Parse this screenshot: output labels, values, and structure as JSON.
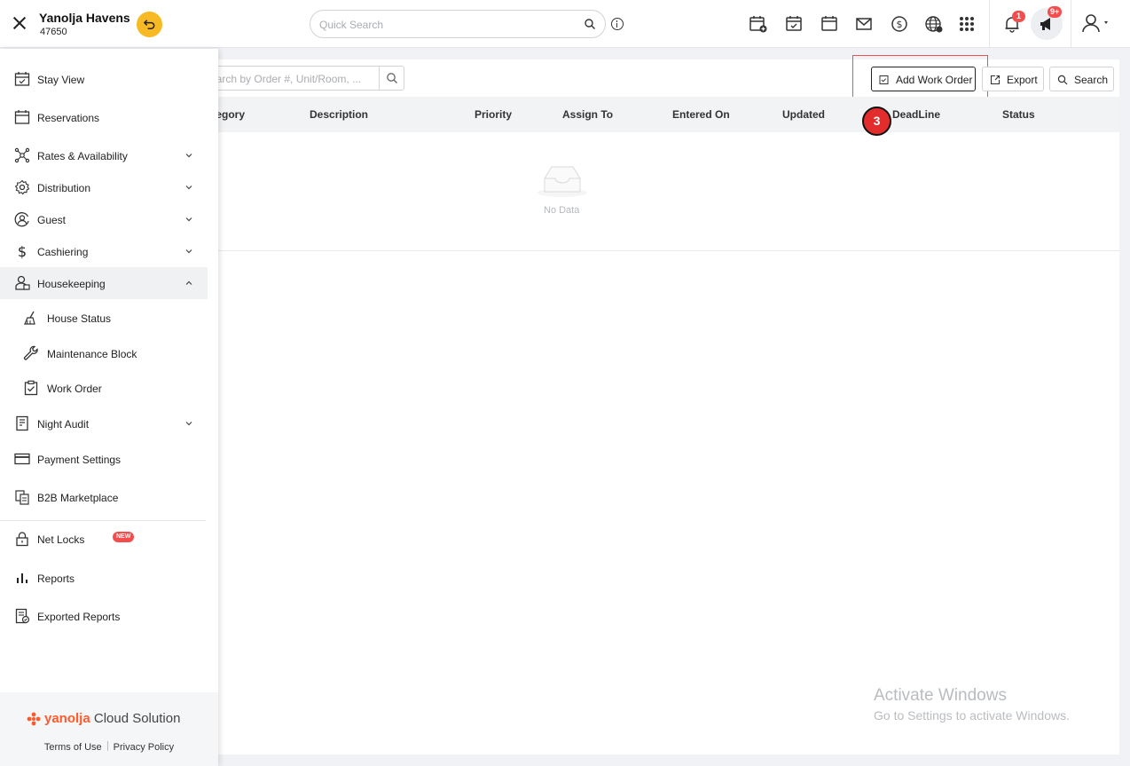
{
  "header": {
    "hotel_name": "Yanolja Havens",
    "hotel_id": "47650",
    "quick_search_placeholder": "Quick Search",
    "notification_count": "1",
    "announcement_count": "9+"
  },
  "sidebar": {
    "items": [
      {
        "label": "Stay View",
        "icon": "calendar-check-icon"
      },
      {
        "label": "Reservations",
        "icon": "calendar-icon"
      },
      {
        "label": "Rates & Availability",
        "icon": "network-icon"
      },
      {
        "label": "Distribution",
        "icon": "gear-icon"
      },
      {
        "label": "Guest",
        "icon": "user-circle-icon"
      },
      {
        "label": "Cashiering",
        "icon": "dollar-icon"
      },
      {
        "label": "Housekeeping",
        "icon": "housekeeping-icon"
      },
      {
        "label": "Night Audit",
        "icon": "document-icon"
      },
      {
        "label": "Payment Settings",
        "icon": "card-icon"
      },
      {
        "label": "B2B Marketplace",
        "icon": "marketplace-icon",
        "badge": "NEW"
      },
      {
        "label": "Net Locks",
        "icon": "lock-icon"
      },
      {
        "label": "Reports",
        "icon": "bar-chart-icon"
      },
      {
        "label": "Exported Reports",
        "icon": "exported-report-icon"
      }
    ],
    "housekeeping_sub": [
      {
        "label": "House Status",
        "icon": "broom-icon"
      },
      {
        "label": "Maintenance Block",
        "icon": "wrench-icon"
      },
      {
        "label": "Work Order",
        "icon": "clipboard-check-icon"
      }
    ],
    "brand_y": "yanolja",
    "brand_rest": " Cloud Solution",
    "terms": "Terms of Use",
    "privacy": "Privacy Policy"
  },
  "main": {
    "search_placeholder": "Search by Order #, Unit/Room, ...",
    "add_work_order": "Add Work Order",
    "export": "Export",
    "search": "Search",
    "step_number": "3",
    "columns": [
      "Category",
      "Description",
      "Priority",
      "Assign To",
      "Entered On",
      "Updated",
      "DeadLine",
      "Status"
    ],
    "no_data": "No Data"
  },
  "watermark": {
    "title": "Activate Windows",
    "subtitle": "Go to Settings to activate Windows."
  },
  "colors": {
    "accent_yellow": "#f7b924",
    "badge_red": "#f44d4d",
    "highlight_red": "#f05050",
    "brand_orange": "#ff5a2c"
  }
}
